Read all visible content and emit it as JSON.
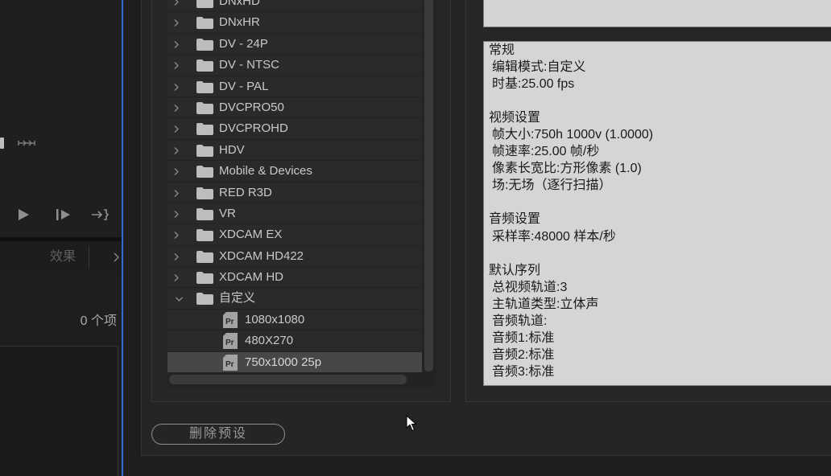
{
  "icons": {
    "monitor_controls": [
      "marker-icon",
      "insert-icon",
      "play-icon",
      "step-forward-icon",
      "go-to-out-icon"
    ],
    "panel_tabs_overflow": "chevron-right-icon",
    "tree_expander": "chevron-right-icon",
    "tree_folder": "folder-icon",
    "tree_preset": "premiere-preset-icon",
    "pointer": "mouse-cursor"
  },
  "colors": {
    "focus_accent": "#2f6fd4",
    "tree_row": "#2a2a2a",
    "tree_row_selected": "#474747",
    "details_bg": "#d5d5d5",
    "details_text": "#1a1a1a"
  },
  "left_panel": {
    "tabs": [
      {
        "label": "效果",
        "active": false
      }
    ],
    "item_count": "0 个项"
  },
  "preset_tree": {
    "preset_icon_text": "Pr",
    "items": [
      {
        "label": "DNxHD",
        "type": "folder",
        "expanded": false
      },
      {
        "label": "DNxHR",
        "type": "folder",
        "expanded": false
      },
      {
        "label": "DV - 24P",
        "type": "folder",
        "expanded": false
      },
      {
        "label": "DV - NTSC",
        "type": "folder",
        "expanded": false
      },
      {
        "label": "DV - PAL",
        "type": "folder",
        "expanded": false
      },
      {
        "label": "DVCPRO50",
        "type": "folder",
        "expanded": false
      },
      {
        "label": "DVCPROHD",
        "type": "folder",
        "expanded": false
      },
      {
        "label": "HDV",
        "type": "folder",
        "expanded": false
      },
      {
        "label": "Mobile & Devices",
        "type": "folder",
        "expanded": false
      },
      {
        "label": "RED R3D",
        "type": "folder",
        "expanded": false
      },
      {
        "label": "VR",
        "type": "folder",
        "expanded": false
      },
      {
        "label": "XDCAM EX",
        "type": "folder",
        "expanded": false
      },
      {
        "label": "XDCAM HD422",
        "type": "folder",
        "expanded": false
      },
      {
        "label": "XDCAM HD",
        "type": "folder",
        "expanded": false
      },
      {
        "label": "自定义",
        "type": "folder",
        "expanded": true
      },
      {
        "label": "1080x1080",
        "type": "preset"
      },
      {
        "label": "480X270",
        "type": "preset"
      },
      {
        "label": "750x1000 25p",
        "type": "preset",
        "selected": true
      }
    ]
  },
  "preset_details": {
    "sections": [
      {
        "heading": "常规",
        "lines": [
          "编辑模式:自定义",
          "时基:25.00 fps"
        ]
      },
      {
        "heading": "视频设置",
        "lines": [
          "帧大小:750h 1000v (1.0000)",
          "帧速率:25.00 帧/秒",
          "像素长宽比:方形像素 (1.0)",
          "场:无场（逐行扫描）"
        ]
      },
      {
        "heading": "音频设置",
        "lines": [
          "采样率:48000 样本/秒"
        ]
      },
      {
        "heading": "默认序列",
        "lines": [
          "总视频轨道:3",
          "主轨道类型:立体声",
          "音频轨道:",
          "音频1:标准",
          "音频2:标准",
          "音频3:标准"
        ]
      }
    ]
  },
  "buttons": {
    "delete_preset": "删除预设"
  }
}
